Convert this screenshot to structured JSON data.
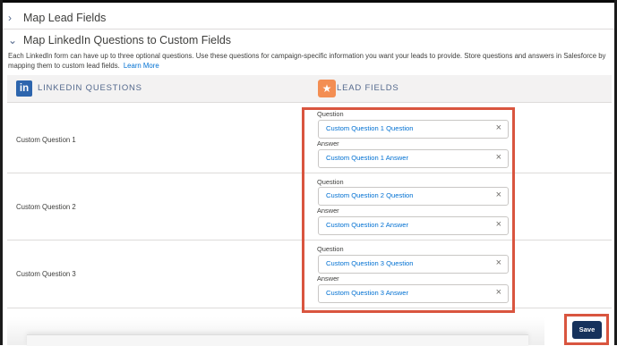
{
  "sections": {
    "lead_fields_title": "Map Lead Fields",
    "linkedin_title": "Map LinkedIn Questions to Custom Fields"
  },
  "description": {
    "text": "Each LinkedIn form can have up to three optional questions. Use these questions for campaign-specific information you want your leads to provide. Store questions and answers in Salesforce by mapping them to custom lead fields.",
    "learn_more": "Learn More"
  },
  "header": {
    "left_icon": "in",
    "left_label": "LINKEDIN QUESTIONS",
    "right_label": "LEAD FIELDS"
  },
  "field_labels": {
    "question": "Question",
    "answer": "Answer"
  },
  "rows": [
    {
      "label": "Custom Question 1",
      "question": "Custom Question 1 Question",
      "answer": "Custom Question 1 Answer"
    },
    {
      "label": "Custom Question 2",
      "question": "Custom Question 2 Question",
      "answer": "Custom Question 2 Answer"
    },
    {
      "label": "Custom Question 3",
      "question": "Custom Question 3 Question",
      "answer": "Custom Question 3 Answer"
    }
  ],
  "save_label": "Save",
  "icons": {
    "chevron_right": "chevron-right-icon",
    "chevron_down": "chevron-down-icon",
    "linkedin": "linkedin-icon",
    "lead": "lead-star-icon",
    "clear": "close-icon"
  },
  "colors": {
    "link": "#0070d2",
    "highlight": "#d9553f",
    "save_button": "#16325c",
    "linkedin": "#2d65ad",
    "lead_badge": "#f38e53"
  }
}
